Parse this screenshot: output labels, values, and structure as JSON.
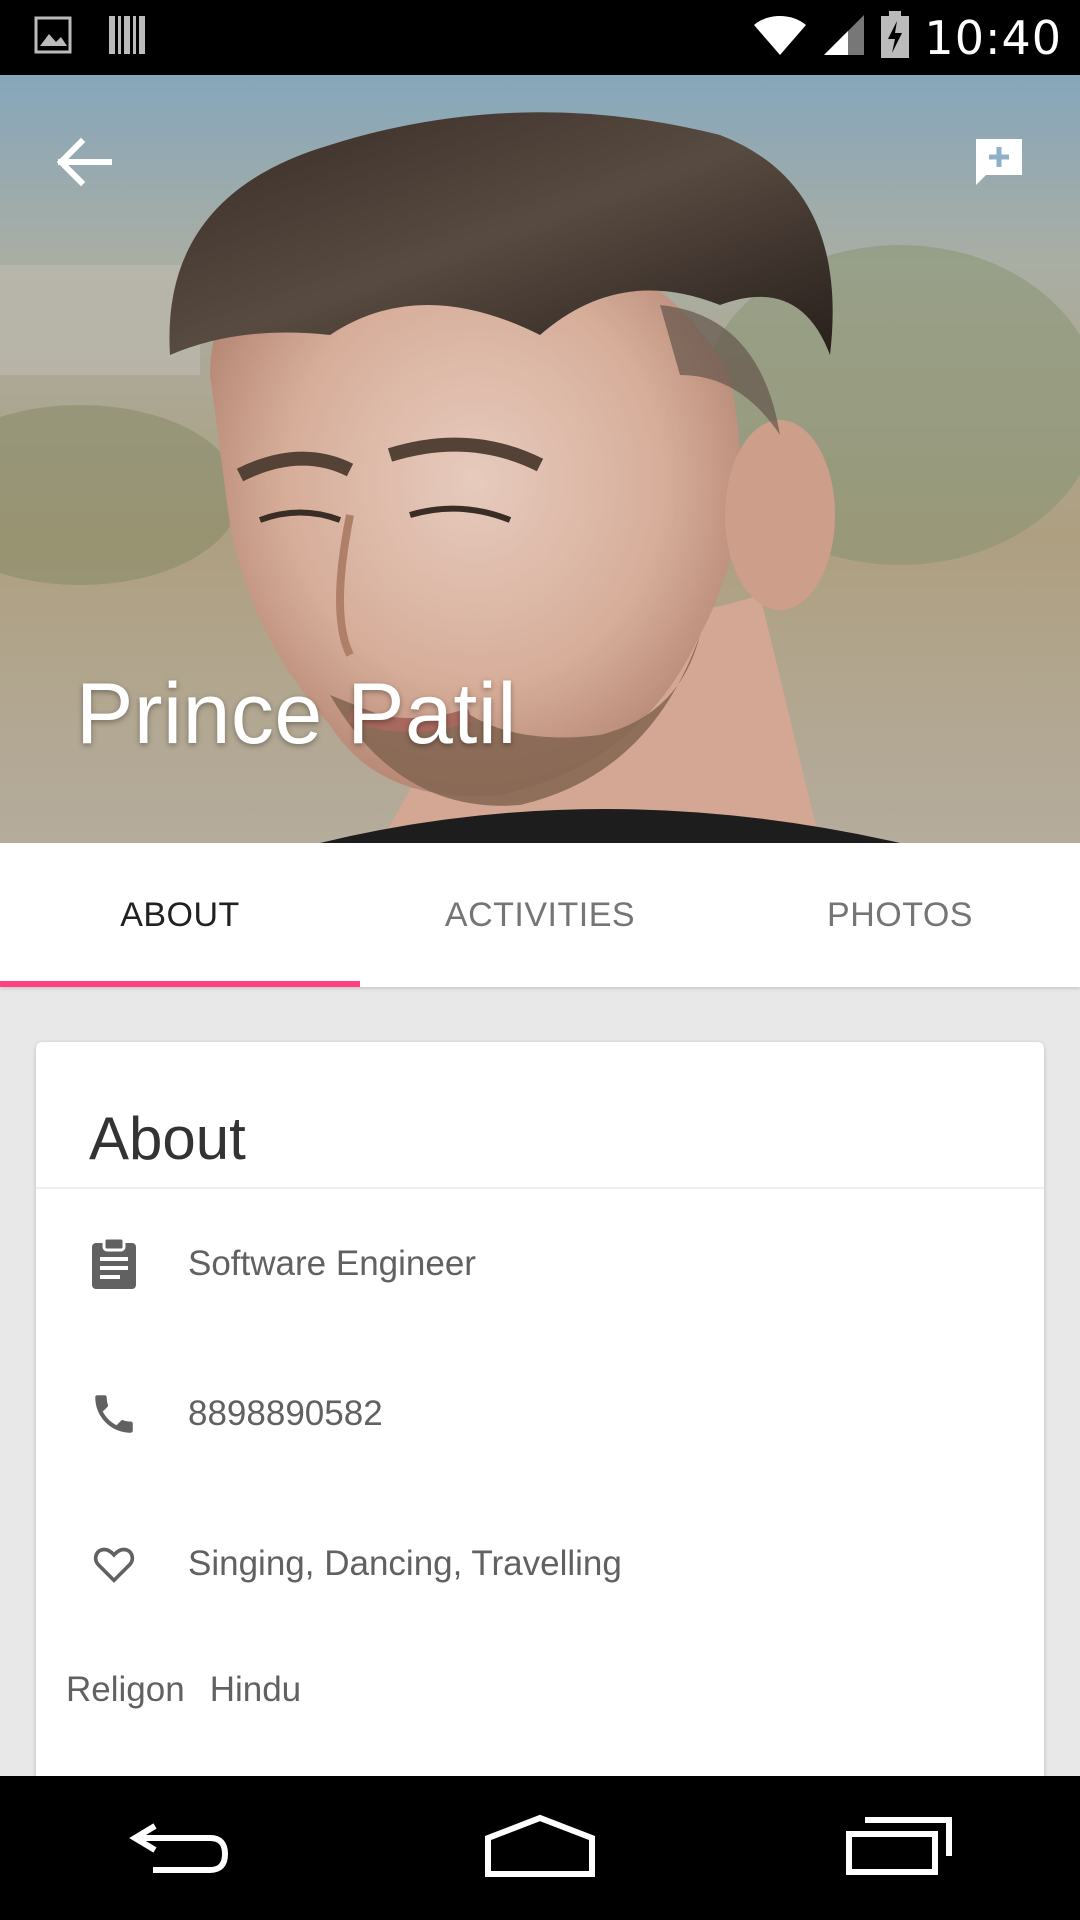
{
  "status_bar": {
    "time": "10:40",
    "left_icons": [
      "image-icon",
      "barcode-icon"
    ],
    "right_icons": [
      "wifi-icon",
      "signal-icon",
      "battery-charging-icon"
    ]
  },
  "profile": {
    "name": "Prince Patil"
  },
  "tabs": [
    {
      "label": "ABOUT",
      "active": true
    },
    {
      "label": "ACTIVITIES",
      "active": false
    },
    {
      "label": "PHOTOS",
      "active": false
    }
  ],
  "about_card": {
    "title": "About",
    "rows": [
      {
        "icon": "clipboard-icon",
        "text": "Software Engineer"
      },
      {
        "icon": "phone-icon",
        "text": "8898890582"
      },
      {
        "icon": "heart-outline-icon",
        "text": "Singing, Dancing, Travelling"
      }
    ],
    "religion_label": "Religon",
    "religion_value": "Hindu"
  },
  "colors": {
    "accent": "#ff4081",
    "tab_active_text": "#212121",
    "tab_inactive_text": "#757575",
    "body_text": "#616161",
    "background": "#e8e8e8"
  }
}
